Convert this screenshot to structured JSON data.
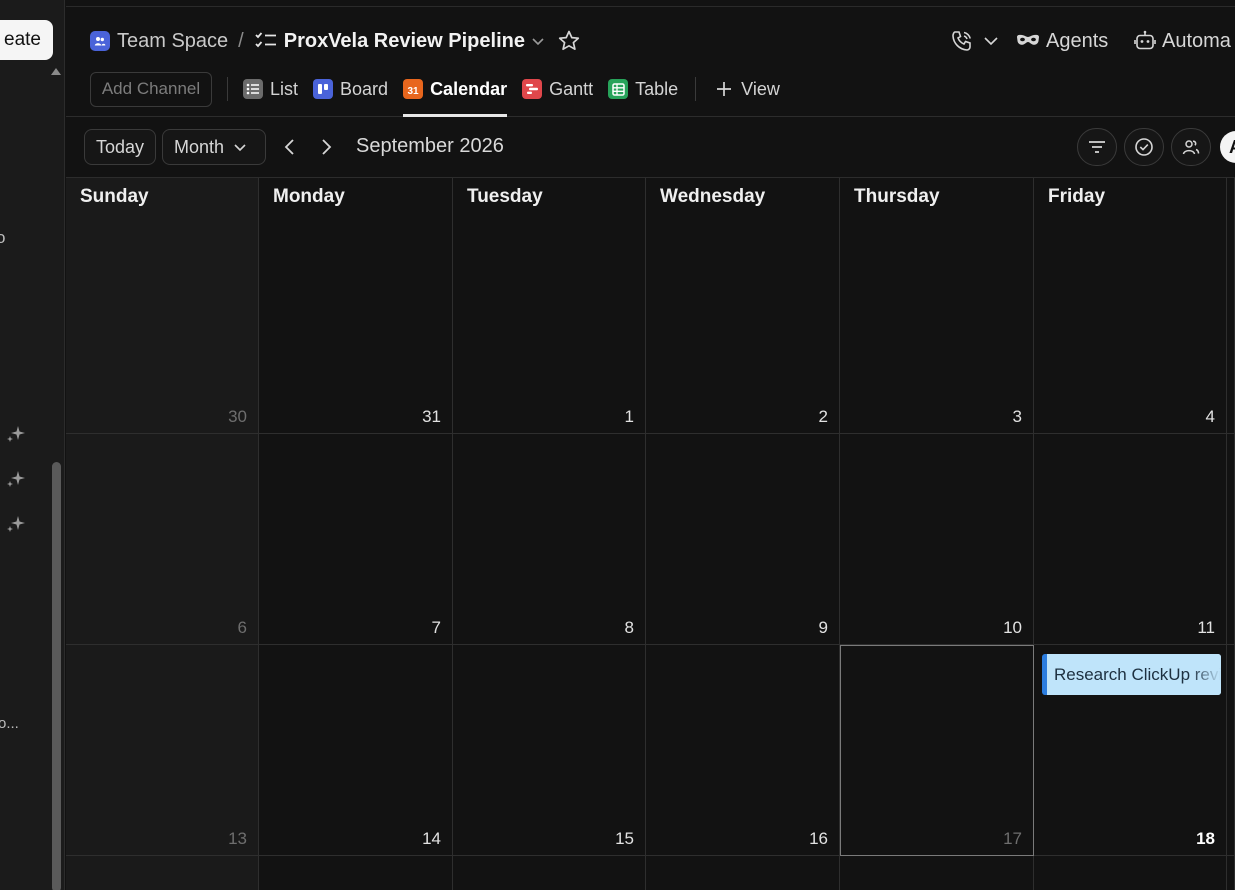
{
  "sidebar": {
    "create_label": "eate",
    "fragment_1": "o",
    "fragment_2": "o..."
  },
  "breadcrumb": {
    "space": "Team Space",
    "separator": "/",
    "list": "ProxVela Review Pipeline"
  },
  "header_actions": {
    "agents_label": "Agents",
    "automations_label": "Automa"
  },
  "views": {
    "add_channel": "Add Channel",
    "tabs": [
      {
        "label": "List",
        "icon": "list-icon",
        "color": "#6b6b6b"
      },
      {
        "label": "Board",
        "icon": "board-icon",
        "color": "#4a63d9"
      },
      {
        "label": "Calendar",
        "icon": "calendar-icon",
        "color": "#e8661d",
        "badge": "31",
        "active": true
      },
      {
        "label": "Gantt",
        "icon": "gantt-icon",
        "color": "#e0474b"
      },
      {
        "label": "Table",
        "icon": "table-icon",
        "color": "#27a35a"
      }
    ],
    "add_view": "View"
  },
  "toolbar": {
    "today": "Today",
    "mode": "Month",
    "period": "September 2026"
  },
  "avatar_initial": "A",
  "calendar": {
    "weekdays": [
      "Sunday",
      "Monday",
      "Tuesday",
      "Wednesday",
      "Thursday",
      "Friday"
    ],
    "weeks": [
      [
        "30",
        "31",
        "1",
        "2",
        "3",
        "4"
      ],
      [
        "6",
        "7",
        "8",
        "9",
        "10",
        "11"
      ],
      [
        "13",
        "14",
        "15",
        "16",
        "17",
        "18"
      ]
    ],
    "today": "17",
    "event": {
      "title": "Research ClickUp review",
      "day": "18"
    }
  }
}
